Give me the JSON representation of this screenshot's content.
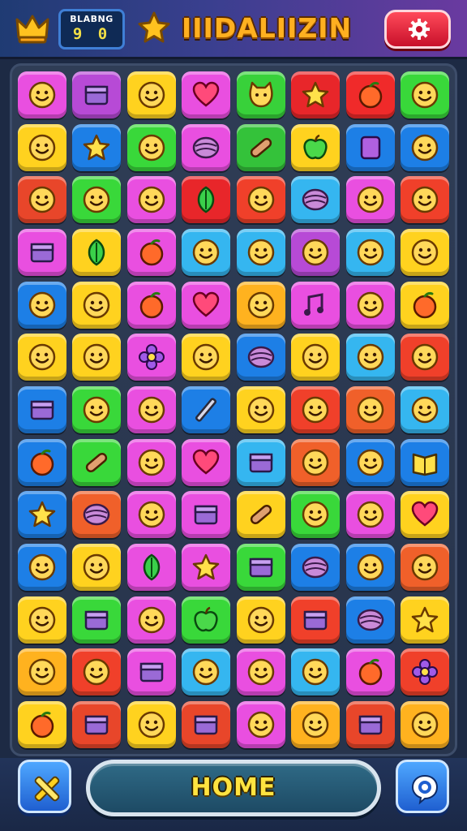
{
  "header": {
    "crown_icon": "crown-icon",
    "score_label": "BLABNG",
    "score_value": "9 0",
    "star_icon": "star-icon",
    "title": "IIIDALIIZIN",
    "settings_icon": "gear-icon"
  },
  "board": {
    "rows": 13,
    "cols": 8,
    "tiles": [
      [
        "#e94fe0|face",
        "#b74ad6|box",
        "#ffd21f|face",
        "#e94fe0|heart",
        "#38d13a|cat",
        "#e8262a|star",
        "#f02a2a|fruit",
        "#39d83a|face"
      ],
      [
        "#ffd21f|face",
        "#1d7fe6|star",
        "#39d83a|face",
        "#e94fe0|ball",
        "#34c23a|bandage",
        "#ffd21f|apple",
        "#1d7fe6|square",
        "#1d7fe6|face"
      ],
      [
        "#e8462a|face",
        "#39d83a|face",
        "#e94fe0|face",
        "#e8262a|leaf",
        "#f0402a|face",
        "#35b6f0|ball",
        "#e94fe0|face",
        "#f0402a|face"
      ],
      [
        "#e94fe0|box",
        "#ffd21f|leaf",
        "#e94fe0|fruit",
        "#35b6f0|face",
        "#35b6f0|face",
        "#b74ad6|face",
        "#35b6f0|face",
        "#ffd21f|face"
      ],
      [
        "#1d7fe6|face",
        "#ffd21f|face",
        "#e94fe0|fruit",
        "#e94fe0|heart",
        "#ffb21f|face",
        "#e94fe0|note",
        "#e94fe0|face",
        "#ffd21f|fruit"
      ],
      [
        "#ffd21f|face",
        "#ffd21f|face",
        "#e94fe0|flower",
        "#ffd21f|face",
        "#1d7fe6|ball",
        "#ffd21f|face",
        "#35b6f0|face",
        "#f0402a|face"
      ],
      [
        "#1d7fe6|box",
        "#39d83a|face",
        "#e94fe0|face",
        "#1d7fe6|wand",
        "#ffd21f|face",
        "#f0402a|face",
        "#f0602a|face",
        "#35b6f0|face"
      ],
      [
        "#1d7fe6|fruit",
        "#39d83a|bandage",
        "#e94fe0|face",
        "#e94fe0|heart",
        "#35b6f0|box",
        "#f0602a|face",
        "#1d7fe6|face",
        "#1d7fe6|book"
      ],
      [
        "#1d7fe6|star",
        "#f0602a|ball",
        "#e94fe0|face",
        "#e94fe0|box",
        "#ffd21f|bandage",
        "#39d83a|face",
        "#e94fe0|face",
        "#ffd21f|heart"
      ],
      [
        "#1d7fe6|face",
        "#ffd21f|face",
        "#e94fe0|leaf",
        "#e94fe0|star",
        "#39d83a|box",
        "#1d7fe6|ball",
        "#1d7fe6|face",
        "#f0602a|face"
      ],
      [
        "#ffd21f|face",
        "#39d83a|box",
        "#e94fe0|face",
        "#39d83a|apple",
        "#ffd21f|face",
        "#f0402a|box",
        "#1d7fe6|ball",
        "#ffd21f|star"
      ],
      [
        "#ffb21f|face",
        "#f0402a|face",
        "#e94fe0|box",
        "#35b6f0|face",
        "#e94fe0|face",
        "#35b6f0|face",
        "#e94fe0|fruit",
        "#f0402a|flower"
      ],
      [
        "#ffd21f|fruit",
        "#e8462a|box",
        "#ffd21f|face",
        "#e8462a|box",
        "#e94fe0|face",
        "#ffb21f|face",
        "#e8462a|box",
        "#ffb21f|face"
      ]
    ]
  },
  "footer": {
    "left_icon": "crossed-tools-icon",
    "home_label": "HOME",
    "right_icon": "hint-bubble-icon"
  }
}
